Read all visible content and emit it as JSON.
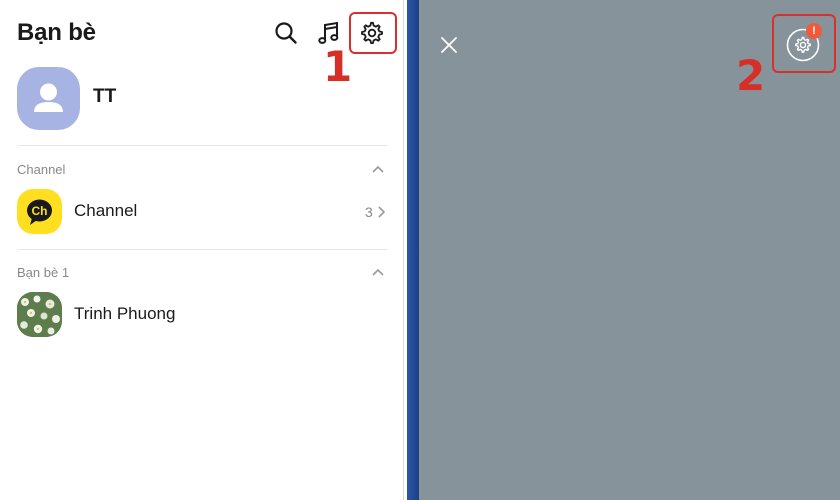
{
  "left_panel": {
    "title": "Bạn bè",
    "profile": {
      "name": "TT"
    },
    "sections": [
      {
        "label": "Channel",
        "items": [
          {
            "name": "Channel",
            "avatar_text": "Ch",
            "count": "3"
          }
        ]
      },
      {
        "label": "Bạn bè 1",
        "items": [
          {
            "name": "Trinh Phuong"
          }
        ]
      }
    ],
    "header_icons": [
      "search-icon",
      "music-note-icon",
      "gear-icon"
    ]
  },
  "annotations": {
    "step1": "1",
    "step2": "2",
    "highlight_color": "#d9302c"
  },
  "right_panel": {
    "badge": "!",
    "background_color": "#87939a",
    "icons": [
      "close-icon",
      "gear-icon"
    ]
  }
}
